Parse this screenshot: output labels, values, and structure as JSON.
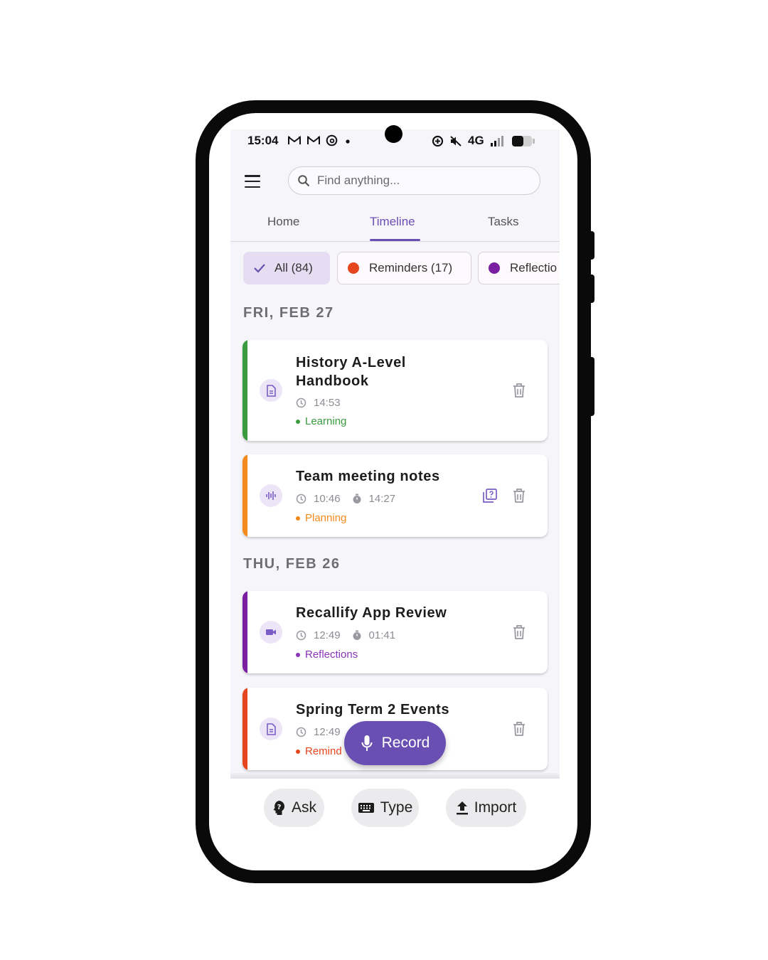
{
  "status_bar": {
    "time": "15:04",
    "network": "4G",
    "left_icons": [
      "gmail-icon",
      "gmail-icon",
      "threads-icon",
      "notification-dot"
    ],
    "right_icons": [
      "data-saver-icon",
      "mute-icon",
      "signal-icon",
      "battery-icon"
    ]
  },
  "search": {
    "placeholder": "Find anything..."
  },
  "tabs": [
    {
      "label": "Home",
      "active": false
    },
    {
      "label": "Timeline",
      "active": true
    },
    {
      "label": "Tasks",
      "active": false
    }
  ],
  "filters": [
    {
      "label": "All (84)",
      "selected": true
    },
    {
      "label": "Reminders (17)",
      "color": "#e6461e"
    },
    {
      "label": "Reflectio",
      "color": "#7a1fa2"
    }
  ],
  "sections": [
    {
      "date": "FRI, FEB 27",
      "entries": [
        {
          "title": "History A-Level Handbook",
          "title_line1": "History A-Level",
          "title_line2": "Handbook",
          "time": "14:53",
          "tag": "Learning",
          "tag_color": "#3a9a3f",
          "accent": "#3a9a3f",
          "icon": "document-icon"
        },
        {
          "title": "Team meeting notes",
          "time": "10:46",
          "duration": "14:27",
          "tag": "Planning",
          "tag_color": "#f28a1c",
          "accent": "#f28a1c",
          "icon": "audio-waveform-icon"
        }
      ]
    },
    {
      "date": "THU, FEB 26",
      "entries": [
        {
          "title": "Recallify App Review",
          "time": "12:49",
          "duration": "01:41",
          "tag": "Reflections",
          "tag_color": "#8a35b8",
          "accent": "#7a1fa2",
          "icon": "video-camera-icon"
        },
        {
          "title": "Spring Term 2 Events",
          "time": "12:49",
          "tag": "Remind",
          "tag_color": "#e6461e",
          "accent": "#e6461e",
          "icon": "document-icon"
        }
      ]
    }
  ],
  "fab": {
    "label": "Record"
  },
  "bottom_actions": [
    {
      "label": "Ask",
      "icon": "ask-icon"
    },
    {
      "label": "Type",
      "icon": "keyboard-icon"
    },
    {
      "label": "Import",
      "icon": "upload-icon"
    }
  ],
  "colors": {
    "accent": "#6a4fb3",
    "chip_selected_bg": "#e6ddf3"
  }
}
